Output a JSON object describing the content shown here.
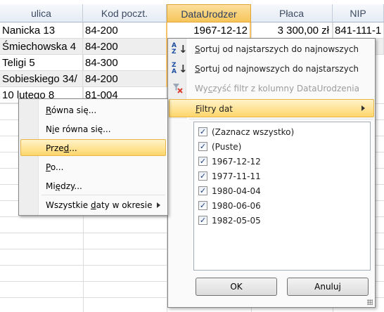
{
  "grid": {
    "headers": [
      "ulica",
      "Kod poczt.",
      "DataUrodzer",
      "Płaca",
      "NIP"
    ],
    "rows": [
      [
        "Nanicka 13",
        "84-200",
        "1967-12-12",
        "3 300,00 zł",
        "841-111-1"
      ],
      [
        "Śmiechowska 4",
        "84-200",
        "",
        "",
        ""
      ],
      [
        "Teligi 5",
        "84-300",
        "",
        "",
        ""
      ],
      [
        "Sobieskiego 34/",
        "84-200",
        "",
        "",
        ""
      ],
      [
        "10 lutego 8",
        "81-004",
        "",
        "",
        ""
      ]
    ],
    "selected_column": "DataUrodzer"
  },
  "filter_menu": {
    "sort_asc": {
      "label_underlined": "S",
      "label_rest": "ortuj od najstarszych do najnowszych",
      "icon": "sort-ascending-icon",
      "icon_text_top": "A",
      "icon_text_bottom": "Z"
    },
    "sort_desc": {
      "label_underlined": "S",
      "label_rest": "ortuj od najnowszych do najstarszych",
      "icon": "sort-descending-icon",
      "icon_text_top": "Z",
      "icon_text_bottom": "A"
    },
    "clear_filter": {
      "label_pre": "Wy",
      "label_underlined": "c",
      "label_rest": "zyść filtr z kolumny DataUrodzenia",
      "icon": "clear-filter-icon"
    },
    "date_filters": {
      "label_underlined": "F",
      "label_rest": "iltry dat"
    },
    "checklist": [
      {
        "label": "(Zaznacz wszystko)",
        "checked": true
      },
      {
        "label": "(Puste)",
        "checked": true
      },
      {
        "label": "1967-12-12",
        "checked": true
      },
      {
        "label": "1977-11-11",
        "checked": true
      },
      {
        "label": "1980-04-04",
        "checked": true
      },
      {
        "label": "1980-06-06",
        "checked": true
      },
      {
        "label": "1982-05-05",
        "checked": true
      }
    ],
    "check_mark": "✓",
    "ok_label": "OK",
    "cancel_label": "Anuluj"
  },
  "submenu": {
    "items": [
      {
        "pre": "",
        "u": "R",
        "rest": "ówna się..."
      },
      {
        "pre": "N",
        "u": "i",
        "rest": "e równa się..."
      },
      {
        "pre": "Prze",
        "u": "d",
        "rest": "..."
      },
      {
        "pre": "",
        "u": "P",
        "rest": "o..."
      },
      {
        "pre": "Mi",
        "u": "ę",
        "rest": "dzy..."
      },
      {
        "pre": "Wszystkie ",
        "u": "d",
        "rest": "aty w okresie"
      }
    ],
    "highlighted_index": 2
  },
  "colors": {
    "header_selected": "#f6c55a",
    "menu_highlight": "#ffd66b"
  }
}
